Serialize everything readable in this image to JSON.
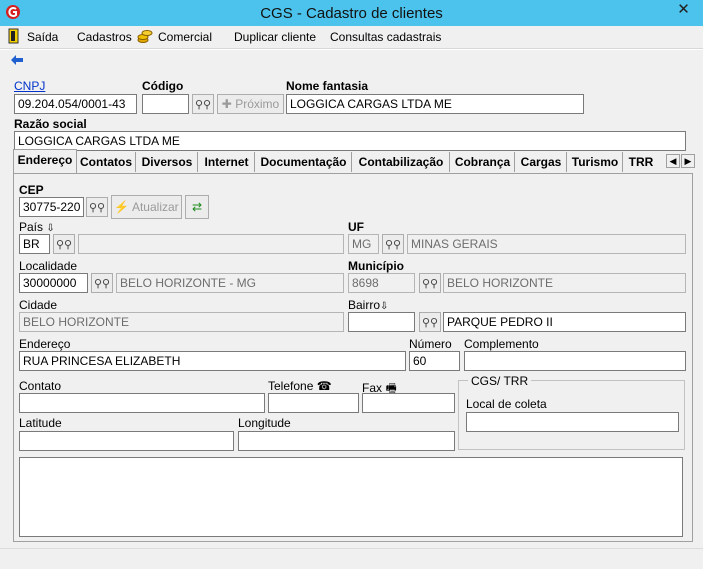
{
  "window": {
    "title": "CGS - Cadastro de clientes",
    "close_glyph": "✕",
    "app_icon": "cgs-logo-icon"
  },
  "menu": {
    "saida": "Saída",
    "cadastros": "Cadastros",
    "comercial": "Comercial",
    "duplicar": "Duplicar cliente",
    "consultas": "Consultas cadastrais"
  },
  "header": {
    "cnpj_label": "CNPJ",
    "cnpj_value": "09.204.054/0001-43",
    "codigo_label": "Código",
    "codigo_value": "",
    "proximo_label": "Próximo",
    "nome_fantasia_label": "Nome fantasia",
    "nome_fantasia_value": "LOGGICA CARGAS LTDA ME",
    "razao_social_label": "Razão social",
    "razao_social_value": "LOGGICA CARGAS LTDA ME"
  },
  "tabs": [
    "Endereço",
    "Contatos",
    "Diversos",
    "Internet",
    "Documentação",
    "Contabilização",
    "Cobrança",
    "Cargas",
    "Turismo",
    "TRR"
  ],
  "endereco": {
    "cep_label": "CEP",
    "cep_value": "30775-220",
    "atualizar_label": "Atualizar",
    "pais_label": "País",
    "pais_value": "BR",
    "pais_desc": "",
    "uf_label": "UF",
    "uf_value": "MG",
    "uf_desc": "MINAS GERAIS",
    "localidade_label": "Localidade",
    "localidade_value": "30000000",
    "localidade_desc": "BELO HORIZONTE - MG",
    "municipio_label": "Município",
    "municipio_value": "8698",
    "municipio_desc": "BELO HORIZONTE",
    "cidade_label": "Cidade",
    "cidade_value": "BELO HORIZONTE",
    "bairro_label": "Bairro",
    "bairro_value": "",
    "bairro_desc": "PARQUE PEDRO II",
    "endereco_label": "Endereço",
    "endereco_value": "RUA PRINCESA ELIZABETH",
    "numero_label": "Número",
    "numero_value": "60",
    "complemento_label": "Complemento",
    "complemento_value": "",
    "contato_label": "Contato",
    "telefone_label": "Telefone",
    "fax_label": "Fax",
    "cgs_trr_label": "CGS/ TRR",
    "local_coleta_label": "Local de coleta",
    "latitude_label": "Latitude",
    "longitude_label": "Longitude",
    "observacoes_value": ""
  },
  "colors": {
    "titlebar": "#4cc3ec",
    "link": "#0033cc"
  }
}
